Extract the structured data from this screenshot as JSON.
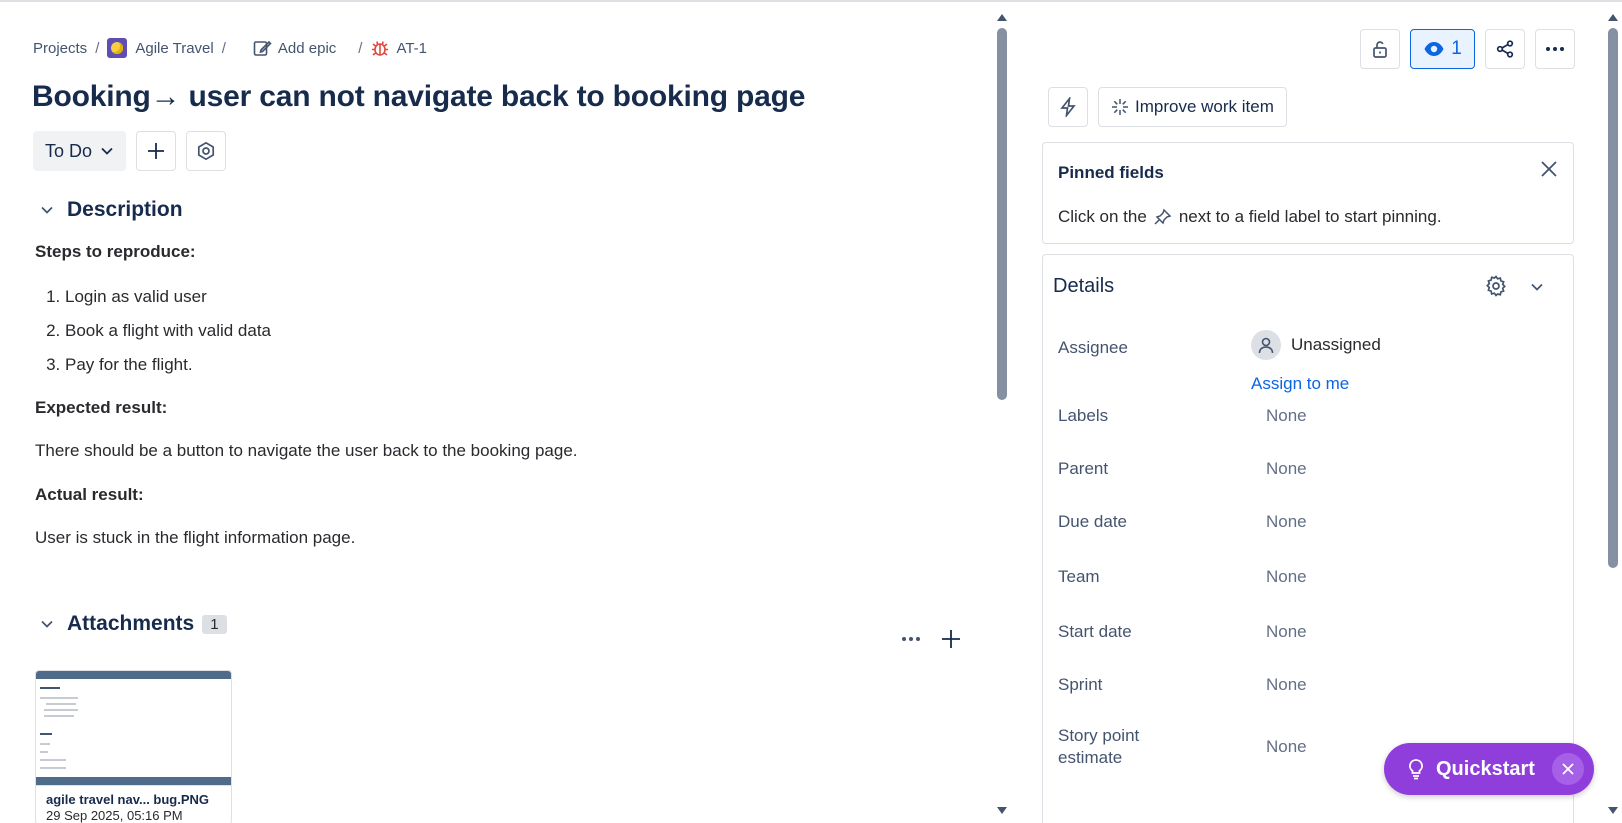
{
  "breadcrumbs": {
    "projects": "Projects",
    "project": "Agile Travel",
    "add_epic": "Add epic",
    "issue_key": "AT-1",
    "separator": "/"
  },
  "title": "Booking→ user can not navigate back to booking page",
  "status": {
    "label": "To Do"
  },
  "description": {
    "heading": "Description",
    "steps_heading": "Steps to reproduce:",
    "steps": [
      "Login as valid user",
      "Book a flight with valid data",
      "Pay for the flight."
    ],
    "expected_heading": "Expected result:",
    "expected": "There should be a button to navigate the user back to the booking page.",
    "actual_heading": "Actual result:",
    "actual": "User is stuck in the flight information page."
  },
  "attachments": {
    "heading": "Attachments",
    "count": "1",
    "items": [
      {
        "name": "agile travel nav... bug.PNG",
        "date": "29 Sep 2025, 05:16 PM"
      }
    ]
  },
  "header_actions": {
    "watch_count": "1"
  },
  "ai": {
    "improve_label": "Improve work item"
  },
  "pinned": {
    "title": "Pinned fields",
    "message_before": "Click on the",
    "message_after": "next to a field label to start pinning."
  },
  "details": {
    "title": "Details",
    "assignee_label": "Assignee",
    "assignee_value": "Unassigned",
    "assign_to_me": "Assign to me",
    "fields": [
      {
        "label": "Labels",
        "value": "None"
      },
      {
        "label": "Parent",
        "value": "None"
      },
      {
        "label": "Due date",
        "value": "None"
      },
      {
        "label": "Team",
        "value": "None"
      },
      {
        "label": "Start date",
        "value": "None"
      },
      {
        "label": "Sprint",
        "value": "None"
      },
      {
        "label": "Story point estimate",
        "value": "None"
      }
    ]
  },
  "quickstart": {
    "label": "Quickstart"
  },
  "colors": {
    "accent": "#0c66e4",
    "quickstart": "#8f3ddb",
    "bug": "#e2483d",
    "project": "#5e4db2"
  }
}
